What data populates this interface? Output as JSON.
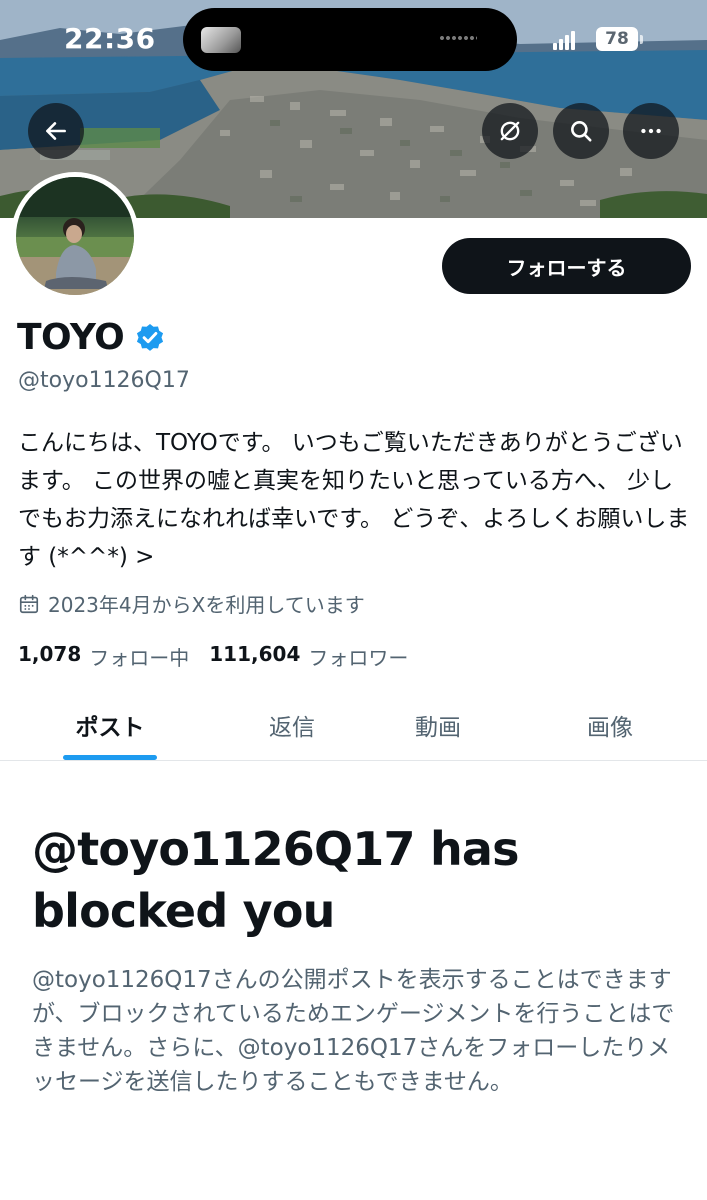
{
  "status_bar": {
    "time": "22:36",
    "battery": "78"
  },
  "header": {
    "back_icon": "arrow-left-icon",
    "mute_icon": "bell-slash-icon",
    "search_icon": "search-icon",
    "more_icon": "ellipsis-icon"
  },
  "profile": {
    "display_name": "TOYO",
    "verified": true,
    "handle": "@toyo1126Q17",
    "follow_label": "フォローする",
    "bio": "こんにちは、TOYOです。 いつもご覧いただきありがとうございます。 この世界の嘘と真実を知りたいと思っている方へ、 少しでもお力添えになれれば幸いです。 どうぞ、よろしくお願いします (*^^*) >",
    "joined": "2023年4月からXを利用しています",
    "following_count": "1,078",
    "following_label": "フォロー中",
    "followers_count": "111,604",
    "followers_label": "フォロワー"
  },
  "tabs": [
    {
      "label": "ポスト",
      "active": true
    },
    {
      "label": "返信",
      "active": false
    },
    {
      "label": "動画",
      "active": false
    },
    {
      "label": "画像",
      "active": false
    }
  ],
  "blocked": {
    "title": "@toyo1126Q17 has blocked you",
    "description": "@toyo1126Q17さんの公開ポストを表示することはできますが、ブロックされているためエンゲージメントを行うことはできません。さらに、@toyo1126Q17さんをフォローしたりメッセージを送信したりすることもできません。"
  },
  "colors": {
    "accent": "#1d9bf0",
    "text_primary": "#0f1419",
    "text_secondary": "#536471",
    "button_dark": "#0f1419"
  }
}
